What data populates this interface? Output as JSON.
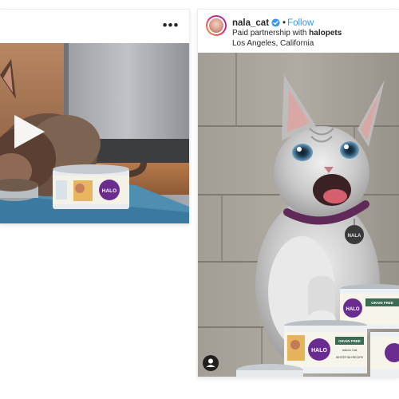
{
  "left_post": {
    "more_icon_glyph": "•••",
    "media_description_icon": "video",
    "can_label": "HALO"
  },
  "right_post": {
    "username": "nala_cat",
    "separator": "•",
    "follow_label": "Follow",
    "partnership_prefix": "Paid partnership with ",
    "partner_brand": "halopets",
    "location": "Los Angeles, California",
    "collar_tag": "NALA",
    "can_label": "HALO",
    "can_text_top": "GRAIN FREE",
    "can_text_line2": "Indoor Cat",
    "can_text_line3": "WHITEFISH RECIPE"
  },
  "colors": {
    "follow_blue": "#3897f0",
    "verified_blue": "#3897f0",
    "halo_purple": "#6a2c8f",
    "text_dark": "#262626"
  }
}
